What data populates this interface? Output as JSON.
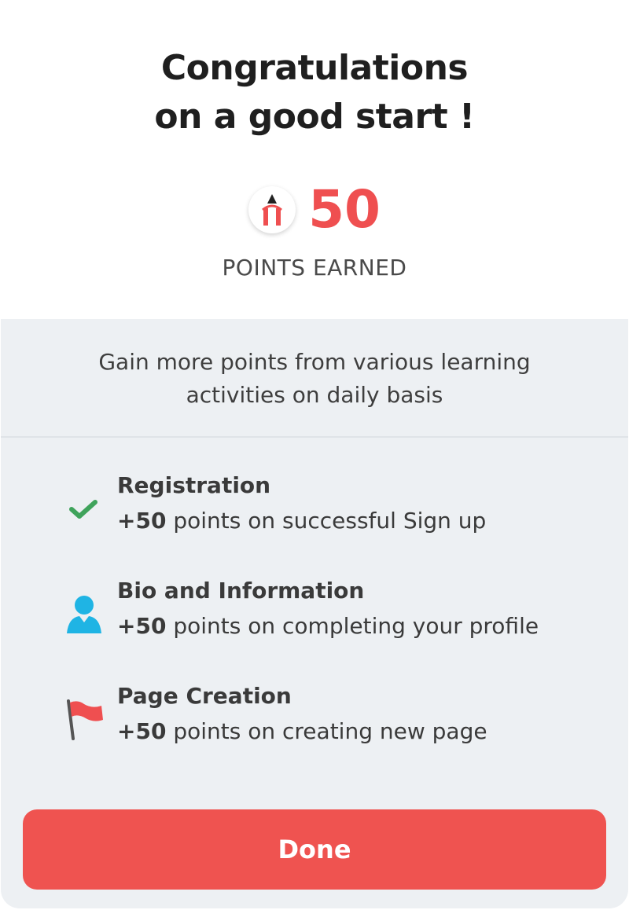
{
  "header": {
    "title_line1": "Congratulations",
    "title_line2": "on a good start !",
    "points_value": "50",
    "points_label": "POINTS EARNED",
    "points_icon": "pencil-icon"
  },
  "intro": {
    "line1": "Gain more points from various learning",
    "line2": "activities on daily basis"
  },
  "activities": [
    {
      "title": "Registration",
      "points": "+50",
      "desc": " points on successful Sign up",
      "icon": "check-icon",
      "color": "#3fa35b"
    },
    {
      "title": "Bio and Information",
      "points": "+50",
      "desc": " points on completing your profile",
      "icon": "user-icon",
      "color": "#1fb4e4"
    },
    {
      "title": "Page Creation",
      "points": "+50",
      "desc": " points on creating new page",
      "icon": "flag-icon",
      "color": "#ef4f50"
    }
  ],
  "actions": {
    "done_label": "Done"
  },
  "colors": {
    "accent": "#ef5350",
    "panel_bg": "#edf0f3"
  }
}
